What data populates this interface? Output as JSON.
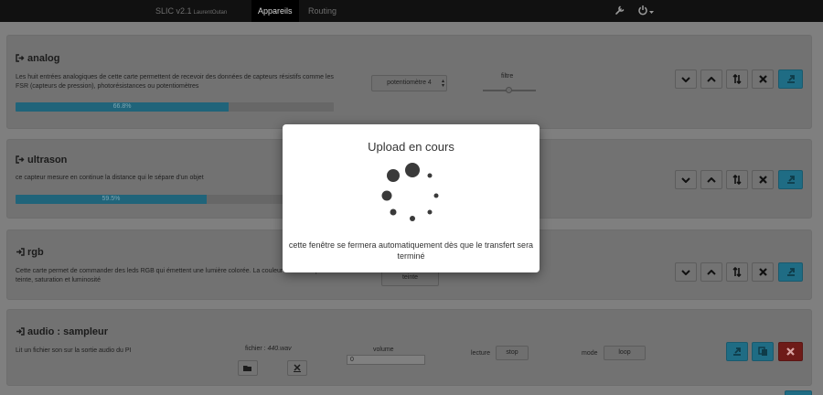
{
  "navbar": {
    "brand": "SLIC v2.1",
    "brand_author": "LaurentOutan",
    "tabs": [
      {
        "label": "Appareils",
        "active": true
      },
      {
        "label": "Routing",
        "active": false
      }
    ],
    "icons": [
      "wrench-icon",
      "power-icon",
      "caret-down-icon"
    ]
  },
  "cards": {
    "analog": {
      "title": "analog",
      "description": "Les huit entrées analogiques de cette carte permettent de recevoir des données de capteurs résistifs comme les FSR (capteurs de pression), photorésistances ou potentiomètres",
      "progress_label": "66.8%",
      "progress_fraction": 0.668,
      "select_value": "potentiomètre 4",
      "slider_label": "filtre",
      "slider_level": 0.5
    },
    "ultrason": {
      "title": "ultrason",
      "description": "ce capteur mesure en continue la distance qui le sépare d'un objet",
      "progress_label": "59.5%",
      "progress_fraction": 0.595
    },
    "rgb": {
      "title": "rgb",
      "description": "Cette carte permet de commander des leds RGB qui émettent une lumière colorée. La couleur est définie par sa teinte, saturation et luminosité",
      "select_value": "teinte"
    },
    "audio": {
      "title": "audio : sampleur",
      "description": "Lit un fichier son sur la sortie audio du PI",
      "file_label": "fichier :",
      "file_name": "440.wav",
      "volume_label": "volume",
      "volume_value": "0",
      "lecture_label": "lecture",
      "lecture_value": "stop",
      "mode_label": "mode",
      "mode_value": "loop"
    }
  },
  "modal": {
    "title": "Upload en cours",
    "message": "cette fenêtre se fermera automatiquement dès que le transfert sera terminé"
  },
  "colors": {
    "primary": "#5bc0de",
    "danger": "#d9534f",
    "navbar": "#222222"
  }
}
